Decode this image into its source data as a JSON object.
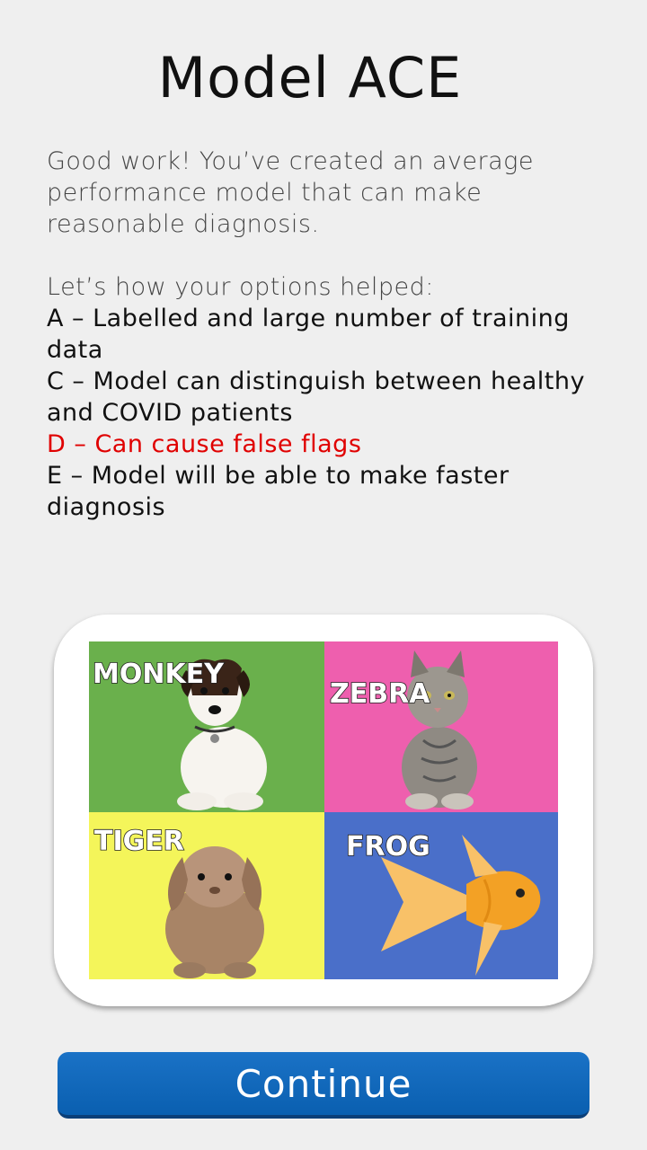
{
  "title": "Model ACE",
  "intro": "Good work! You’ve created an average performance model that can make reasonable diagnosis.",
  "lead": "Let’s how your options helped:",
  "options": [
    {
      "text": "A – Labelled and large number of training data",
      "negative": false
    },
    {
      "text": "C – Model can distinguish between healthy and COVID patients",
      "negative": false
    },
    {
      "text": "D – Can cause false flags",
      "negative": true
    },
    {
      "text": "E – Model will be able to make faster diagnosis",
      "negative": false
    }
  ],
  "image": {
    "quadrants": [
      {
        "label": "MONKEY",
        "animal": "dog",
        "bg": "#6ab04c"
      },
      {
        "label": "ZEBRA",
        "animal": "cat",
        "bg": "#ee5fae"
      },
      {
        "label": "TIGER",
        "animal": "rabbit",
        "bg": "#f4f55a"
      },
      {
        "label": "FROG",
        "animal": "goldfish",
        "bg": "#4a6fc9"
      }
    ]
  },
  "colors": {
    "background": "#efefef",
    "negative_text": "#e00000",
    "button": "#0a66b8"
  },
  "continue_label": "Continue"
}
